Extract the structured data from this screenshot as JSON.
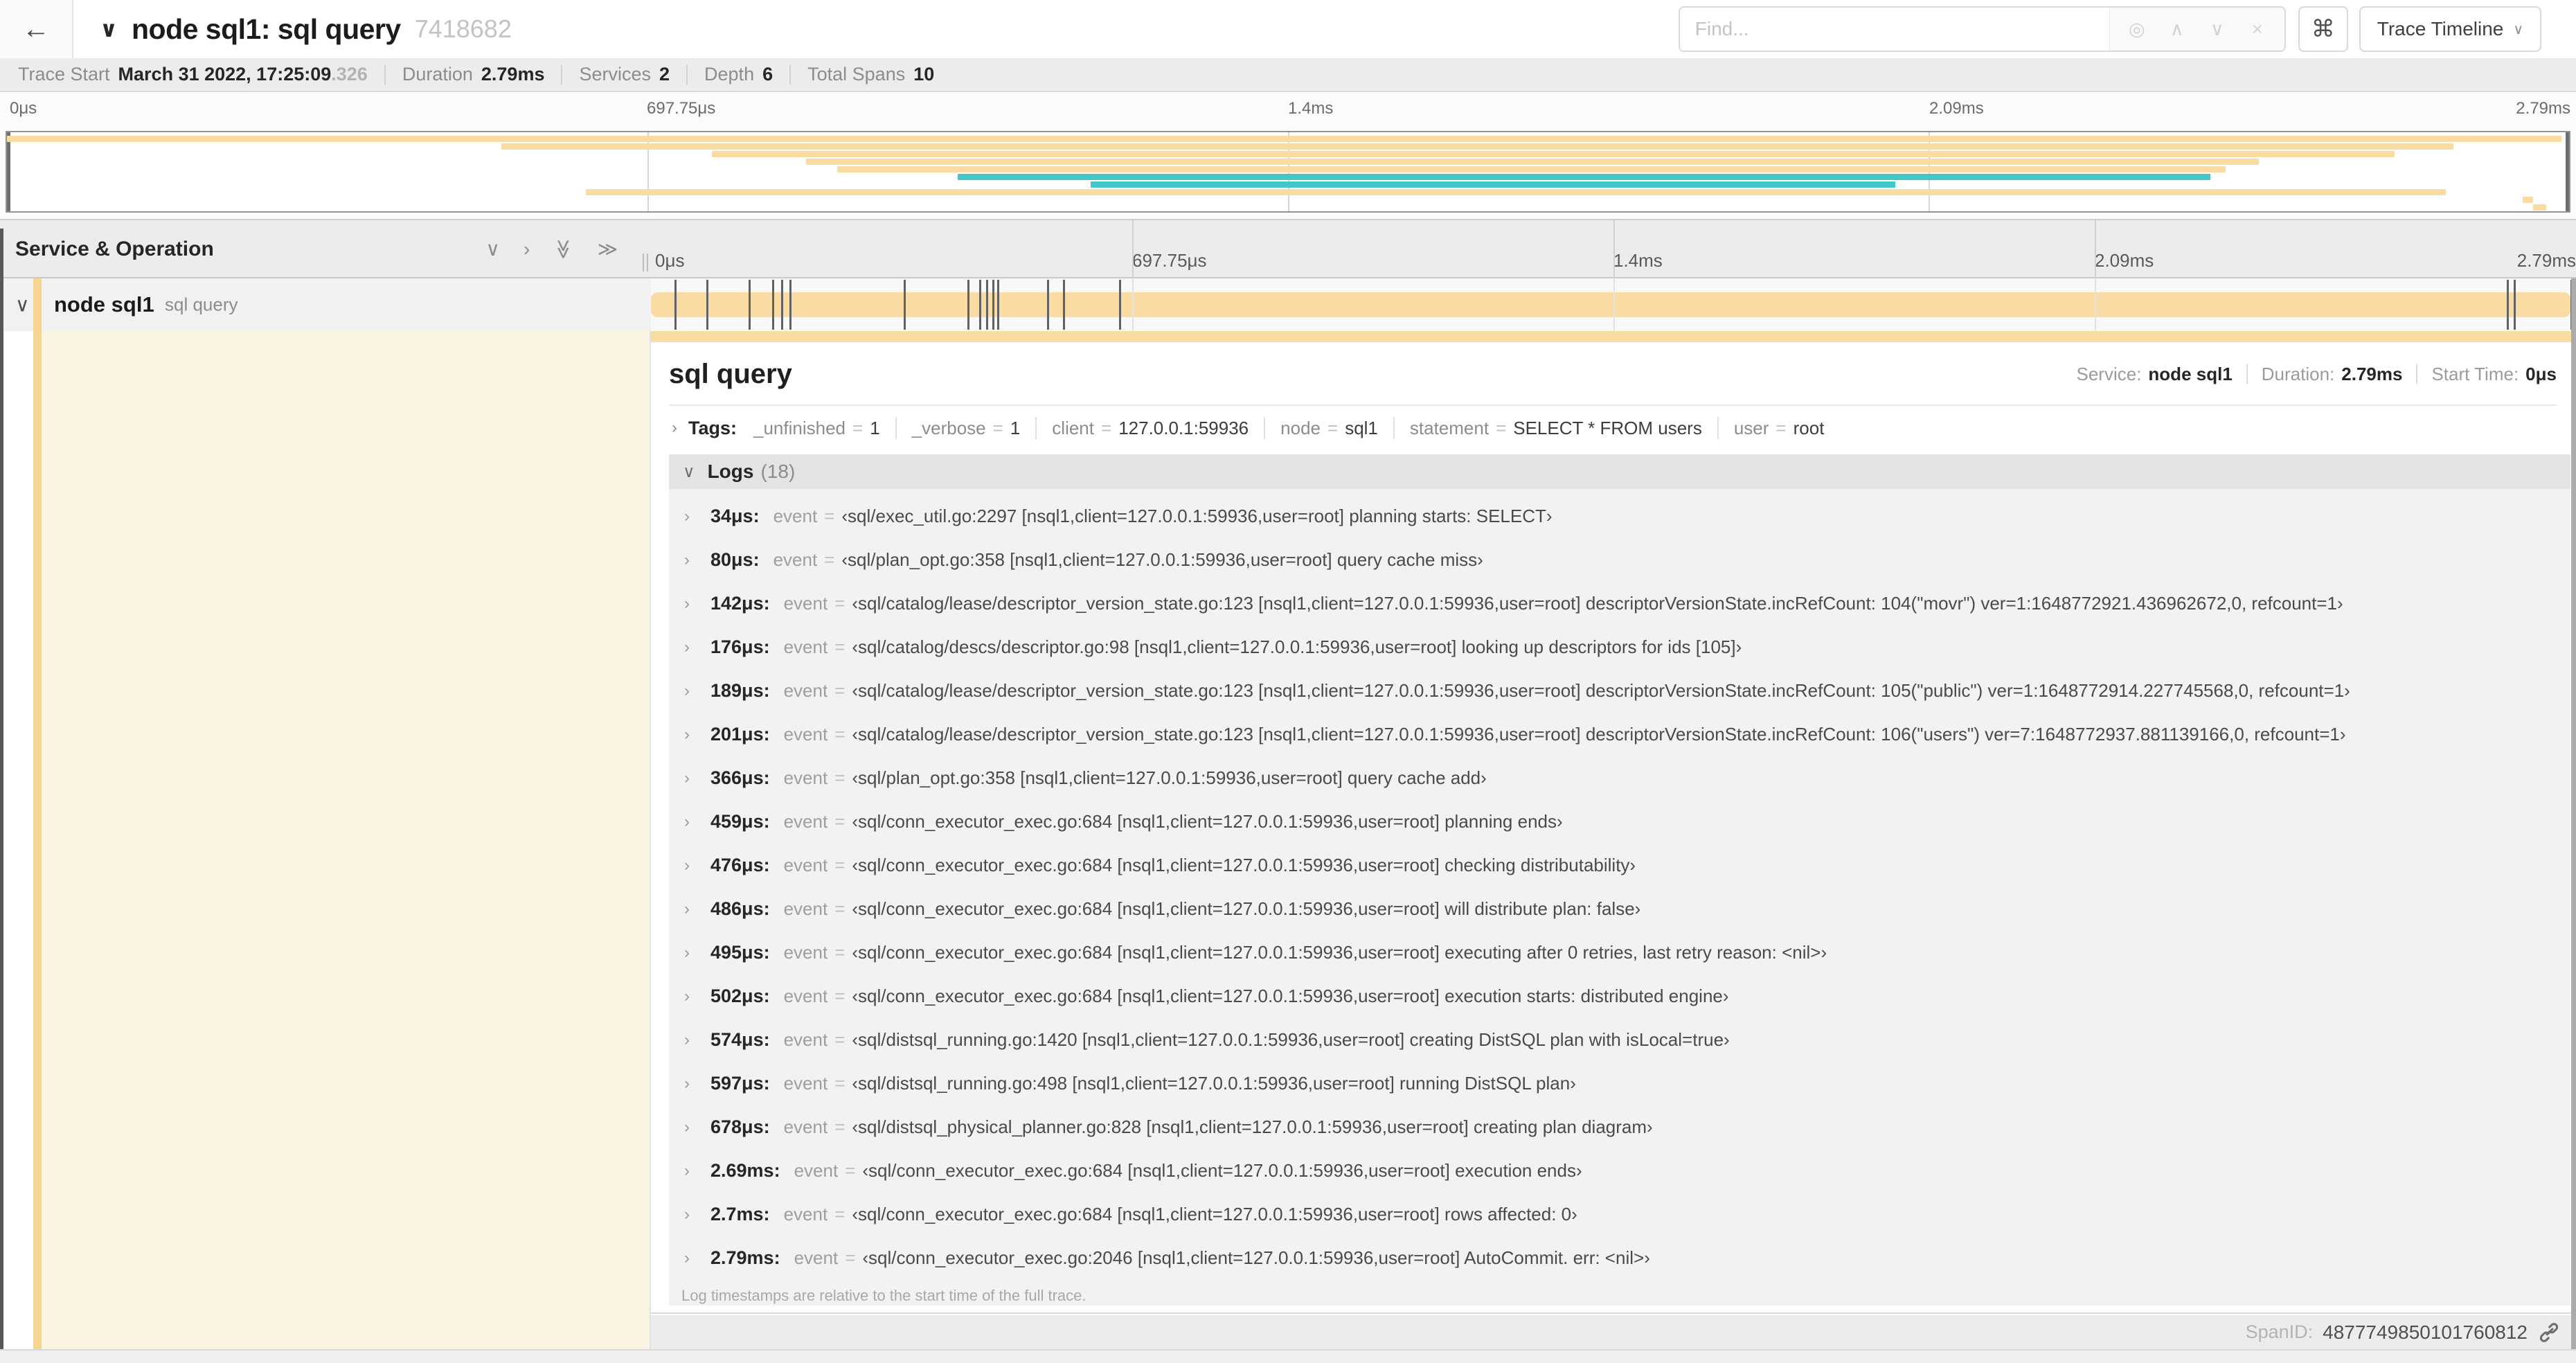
{
  "colors": {
    "tan": "#f8dca4",
    "teal": "#45c7c7",
    "stripe": "#f6d590"
  },
  "header": {
    "back_icon": "←",
    "collapse_icon": "∨",
    "title": "node sql1: sql query",
    "trace_id": "7418682",
    "find_placeholder": "Find...",
    "locate_icon": "◎",
    "prev_icon": "∧",
    "next_icon": "∨",
    "clear_icon": "×",
    "command_icon": "⌘",
    "view_button": "Trace Timeline",
    "view_caret": "∨"
  },
  "summary": {
    "items": [
      {
        "label": "Trace Start",
        "value": "March 31 2022, 17:25:09",
        "fraction": ".326"
      },
      {
        "label": "Duration",
        "value": "2.79ms"
      },
      {
        "label": "Services",
        "value": "2"
      },
      {
        "label": "Depth",
        "value": "6"
      },
      {
        "label": "Total Spans",
        "value": "10"
      }
    ]
  },
  "timeline": {
    "duration_us": 2790,
    "ticks": [
      {
        "label": "0μs",
        "pct": 0
      },
      {
        "label": "697.75μs",
        "pct": 25
      },
      {
        "label": "1.4ms",
        "pct": 50
      },
      {
        "label": "2.09ms",
        "pct": 75
      },
      {
        "label": "2.79ms",
        "pct": 100
      }
    ]
  },
  "minimap": {
    "spans": [
      {
        "s": 0,
        "e": 99.7,
        "c": "tan"
      },
      {
        "s": 19.3,
        "e": 95.5,
        "c": "tan"
      },
      {
        "s": 27.5,
        "e": 93.2,
        "c": "tan"
      },
      {
        "s": 31.2,
        "e": 87.9,
        "c": "tan"
      },
      {
        "s": 32.4,
        "e": 86.6,
        "c": "tan"
      },
      {
        "s": 37.1,
        "e": 86.0,
        "c": "teal"
      },
      {
        "s": 42.3,
        "e": 73.7,
        "c": "teal"
      },
      {
        "s": 22.6,
        "e": 95.2,
        "c": "tan"
      },
      {
        "s": 98.2,
        "e": 98.6,
        "c": "tan"
      },
      {
        "s": 98.6,
        "e": 99.1,
        "c": "tan"
      }
    ]
  },
  "so_header": {
    "title": "Service & Operation",
    "collapse_one_icon": "∨",
    "expand_one_icon": "›",
    "collapse_all_icon": "≫",
    "expand_all_icon": "≫"
  },
  "span_row": {
    "caret": "∨",
    "service": "node sql1",
    "operation": "sql query"
  },
  "detail": {
    "title": "sql query",
    "service_label": "Service:",
    "service": "node sql1",
    "duration_label": "Duration:",
    "duration": "2.79ms",
    "start_label": "Start Time:",
    "start": "0μs",
    "tags_chevron": "›",
    "tags_label": "Tags:",
    "tags": [
      {
        "key": "_unfinished",
        "value": "1"
      },
      {
        "key": "_verbose",
        "value": "1"
      },
      {
        "key": "client",
        "value": "127.0.0.1:59936"
      },
      {
        "key": "node",
        "value": "sql1"
      },
      {
        "key": "statement",
        "value": "SELECT * FROM users"
      },
      {
        "key": "user",
        "value": "root"
      }
    ],
    "logs_caret": "∨",
    "logs_label": "Logs",
    "logs_count": "(18)",
    "row_chevron": "›",
    "field_name": "event",
    "eq_sign": "=",
    "logs": [
      {
        "t": "34μs:",
        "us": 34,
        "value": "‹sql/exec_util.go:2297 [nsql1,client=127.0.0.1:59936,user=root] planning starts: SELECT›"
      },
      {
        "t": "80μs:",
        "us": 80,
        "value": "‹sql/plan_opt.go:358 [nsql1,client=127.0.0.1:59936,user=root] query cache miss›"
      },
      {
        "t": "142μs:",
        "us": 142,
        "value": "‹sql/catalog/lease/descriptor_version_state.go:123 [nsql1,client=127.0.0.1:59936,user=root] descriptorVersionState.incRefCount: 104(\"movr\") ver=1:1648772921.436962672,0, refcount=1›"
      },
      {
        "t": "176μs:",
        "us": 176,
        "value": "‹sql/catalog/descs/descriptor.go:98 [nsql1,client=127.0.0.1:59936,user=root] looking up descriptors for ids [105]›"
      },
      {
        "t": "189μs:",
        "us": 189,
        "value": "‹sql/catalog/lease/descriptor_version_state.go:123 [nsql1,client=127.0.0.1:59936,user=root] descriptorVersionState.incRefCount: 105(\"public\") ver=1:1648772914.227745568,0, refcount=1›"
      },
      {
        "t": "201μs:",
        "us": 201,
        "value": "‹sql/catalog/lease/descriptor_version_state.go:123 [nsql1,client=127.0.0.1:59936,user=root] descriptorVersionState.incRefCount: 106(\"users\") ver=7:1648772937.881139166,0, refcount=1›"
      },
      {
        "t": "366μs:",
        "us": 366,
        "value": "‹sql/plan_opt.go:358 [nsql1,client=127.0.0.1:59936,user=root] query cache add›"
      },
      {
        "t": "459μs:",
        "us": 459,
        "value": "‹sql/conn_executor_exec.go:684 [nsql1,client=127.0.0.1:59936,user=root] planning ends›"
      },
      {
        "t": "476μs:",
        "us": 476,
        "value": "‹sql/conn_executor_exec.go:684 [nsql1,client=127.0.0.1:59936,user=root] checking distributability›"
      },
      {
        "t": "486μs:",
        "us": 486,
        "value": "‹sql/conn_executor_exec.go:684 [nsql1,client=127.0.0.1:59936,user=root] will distribute plan: false›"
      },
      {
        "t": "495μs:",
        "us": 495,
        "value": "‹sql/conn_executor_exec.go:684 [nsql1,client=127.0.0.1:59936,user=root] executing after 0 retries, last retry reason: <nil>›"
      },
      {
        "t": "502μs:",
        "us": 502,
        "value": "‹sql/conn_executor_exec.go:684 [nsql1,client=127.0.0.1:59936,user=root] execution starts: distributed engine›"
      },
      {
        "t": "574μs:",
        "us": 574,
        "value": "‹sql/distsql_running.go:1420 [nsql1,client=127.0.0.1:59936,user=root] creating DistSQL plan with isLocal=true›"
      },
      {
        "t": "597μs:",
        "us": 597,
        "value": "‹sql/distsql_running.go:498 [nsql1,client=127.0.0.1:59936,user=root] running DistSQL plan›"
      },
      {
        "t": "678μs:",
        "us": 678,
        "value": "‹sql/distsql_physical_planner.go:828 [nsql1,client=127.0.0.1:59936,user=root] creating plan diagram›"
      },
      {
        "t": "2.69ms:",
        "us": 2690,
        "value": "‹sql/conn_executor_exec.go:684 [nsql1,client=127.0.0.1:59936,user=root] execution ends›"
      },
      {
        "t": "2.7ms:",
        "us": 2700,
        "value": "‹sql/conn_executor_exec.go:684 [nsql1,client=127.0.0.1:59936,user=root] rows affected: 0›"
      },
      {
        "t": "2.79ms:",
        "us": 2790,
        "value": "‹sql/conn_executor_exec.go:2046 [nsql1,client=127.0.0.1:59936,user=root] AutoCommit. err: <nil>›"
      }
    ],
    "logs_note": "Log timestamps are relative to the start time of the full trace.",
    "span_id_label": "SpanID:",
    "span_id": "4877749850101760812"
  }
}
